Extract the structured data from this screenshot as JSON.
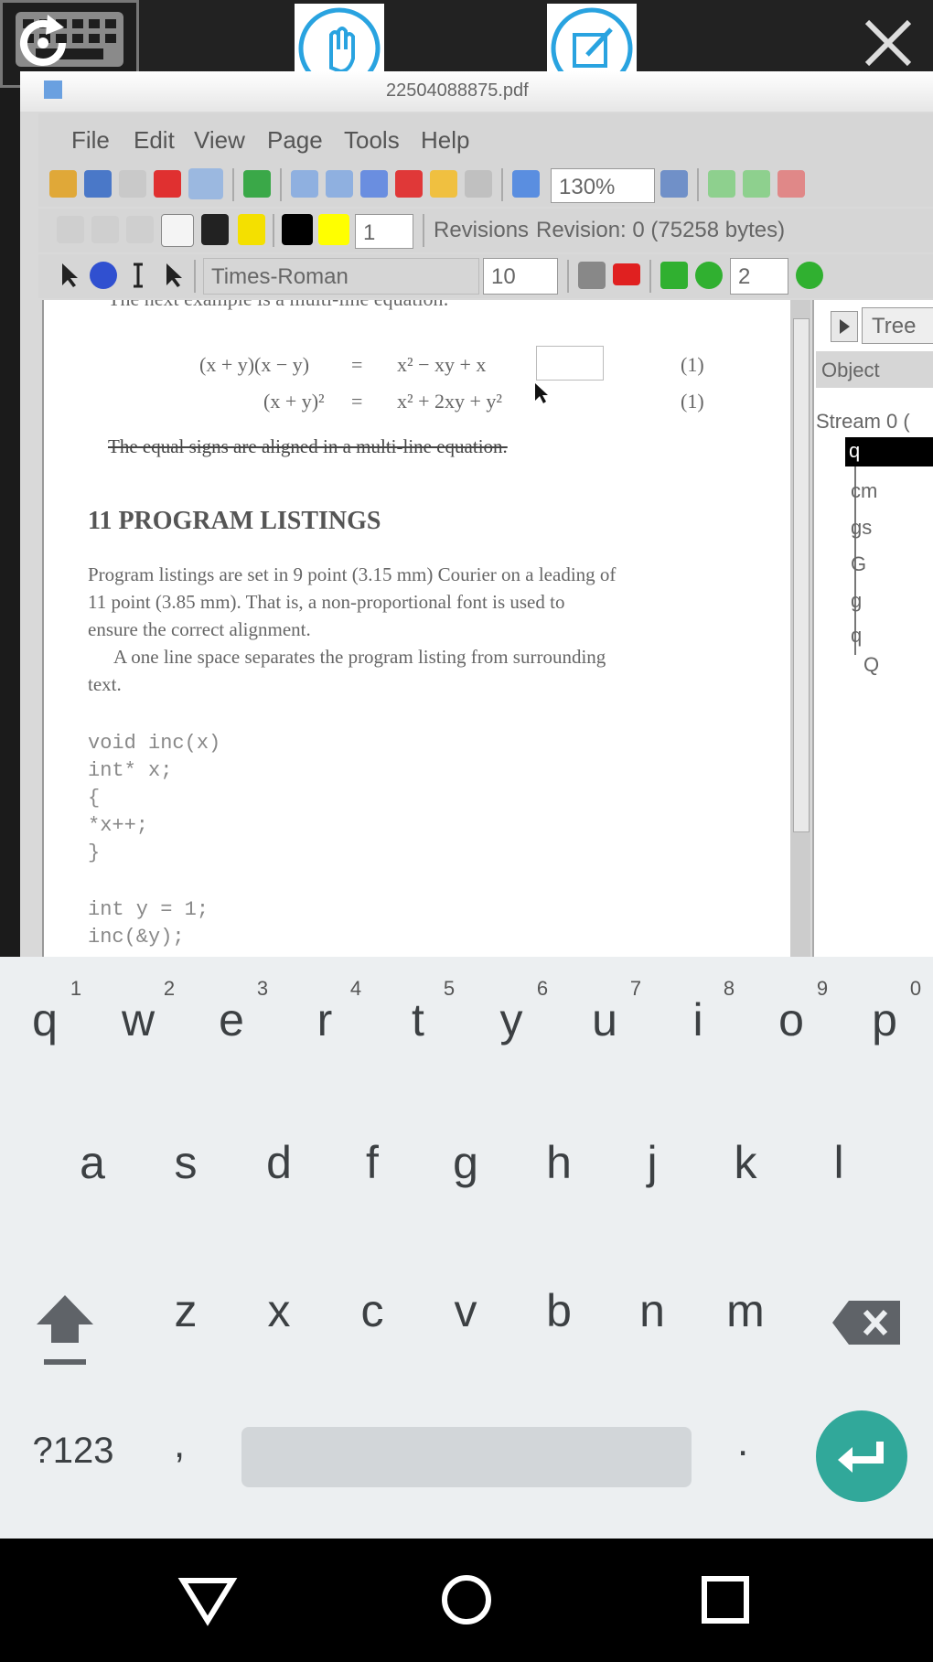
{
  "remote_window": {
    "title": "22504088875.pdf",
    "menu": [
      "File",
      "Edit",
      "View",
      "Page",
      "Tools",
      "Help"
    ],
    "toolbar": {
      "zoom": "130%",
      "line_width": "1",
      "revisions_label": "Revisions",
      "revision_value": "Revision: 0 (75258 bytes)",
      "font": "Times-Roman",
      "font_size": "10",
      "page_number": "2"
    }
  },
  "document": {
    "top_line": "The next example is a multi-line equation:",
    "equations": [
      {
        "lhs": "(x + y)(x − y)",
        "eq": "=",
        "rhs": "x² − xy + x",
        "num": "(1)"
      },
      {
        "lhs": "(x + y)²",
        "eq": "=",
        "rhs": "x² + 2xy + y²",
        "num": "(1)"
      }
    ],
    "struck_line": "The equal signs are aligned in a multi-line equation.",
    "section_heading": "11   PROGRAM LISTINGS",
    "para1": [
      "Program listings are set in 9 point (3.15 mm) Courier on a leading of",
      "11 point (3.85 mm). That is, a non-proportional font is used to",
      "ensure the correct alignment."
    ],
    "para2": [
      "A one line space separates the program listing from surrounding",
      "text."
    ],
    "code": [
      "void inc(x)",
      "int* x;",
      "{",
      "   *x++;",
      "}",
      "",
      "int y = 1;",
      "inc(&y);"
    ]
  },
  "right_panel": {
    "tab_label": "Tree",
    "header": "Object",
    "stream": "Stream 0 (",
    "selected": "q",
    "items": [
      "cm",
      "gs",
      "G",
      "g",
      "q",
      "Q"
    ]
  },
  "keyboard": {
    "row1": [
      "q",
      "w",
      "e",
      "r",
      "t",
      "y",
      "u",
      "i",
      "o",
      "p"
    ],
    "row1_hints": [
      "1",
      "2",
      "3",
      "4",
      "5",
      "6",
      "7",
      "8",
      "9",
      "0"
    ],
    "row2": [
      "a",
      "s",
      "d",
      "f",
      "g",
      "h",
      "j",
      "k",
      "l"
    ],
    "row3": [
      "z",
      "x",
      "c",
      "v",
      "b",
      "n",
      "m"
    ],
    "symbols_key": "?123",
    "comma_key": ",",
    "period_key": "."
  },
  "colors": {
    "accent_blue": "#29a3e0",
    "enter_teal": "#31a89a"
  }
}
